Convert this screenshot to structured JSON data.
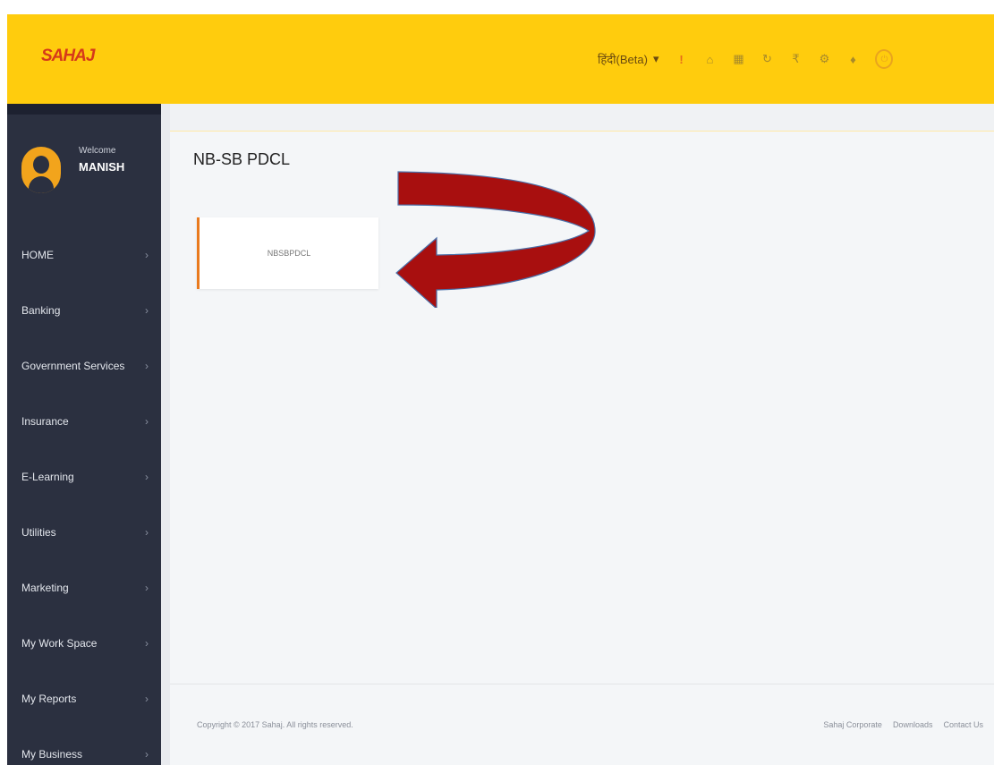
{
  "header": {
    "logo": "SAHAJ",
    "language": "हिंदी(Beta)",
    "language_chevron": "▾",
    "icons": [
      "alert-icon",
      "home-icon",
      "grid-icon",
      "refresh-icon",
      "wallet-icon",
      "settings-icon",
      "bell-icon",
      "power-icon"
    ]
  },
  "sidebar": {
    "welcome": "Welcome",
    "user": "MANISH",
    "items": [
      {
        "label": "HOME"
      },
      {
        "label": "Banking"
      },
      {
        "label": "Government Services"
      },
      {
        "label": "Insurance"
      },
      {
        "label": "E-Learning"
      },
      {
        "label": "Utilities"
      },
      {
        "label": "Marketing"
      },
      {
        "label": "My Work Space"
      },
      {
        "label": "My Reports"
      },
      {
        "label": "My Business"
      }
    ]
  },
  "main": {
    "title": "NB-SB PDCL",
    "card_label": "NBSBPDCL"
  },
  "footer": {
    "copyright": "Copyright © 2017 Sahaj. All rights reserved.",
    "links": [
      "Sahaj Corporate",
      "Downloads",
      "Contact Us"
    ]
  },
  "colors": {
    "header": "#ffcc0d",
    "sidebar": "#2b3040",
    "accent": "#e97a1e",
    "arrow": "#a80f0f"
  }
}
